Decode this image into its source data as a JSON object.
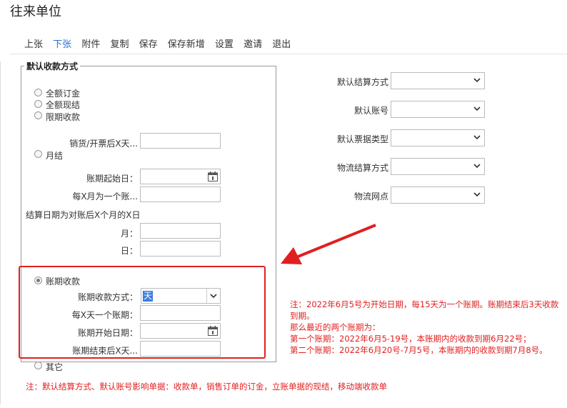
{
  "title": "往来单位",
  "toolbar": [
    {
      "label": "上张"
    },
    {
      "label": "下张"
    },
    {
      "label": "附件"
    },
    {
      "label": "复制"
    },
    {
      "label": "保存"
    },
    {
      "label": "保存新增"
    },
    {
      "label": "设置"
    },
    {
      "label": "邀请"
    },
    {
      "label": "退出"
    }
  ],
  "fieldset_legend": "默认收款方式",
  "radios": {
    "full_order": "全额订金",
    "full_cash": "全额现结",
    "limited": "限期收款",
    "monthly": "月结",
    "period": "账期收款",
    "other": "其它"
  },
  "fields": {
    "sale_after_days": "销货/开票后X天...",
    "period_start_date": "账期起始日：",
    "every_x_months": "每X月为一个账...",
    "settle_desc": "结算日期为对账后X个月的X日",
    "month": "月：",
    "day": "日：",
    "period_method": "账期收款方式：",
    "period_method_value": "天",
    "every_x_days": "每X天一个账期：",
    "period_begin_date": "账期开始日期：",
    "period_end_after": "账期结束后X天..."
  },
  "right_fields": [
    {
      "label": "默认结算方式"
    },
    {
      "label": "默认账号"
    },
    {
      "label": "默认票据类型"
    },
    {
      "label": "物流结算方式"
    },
    {
      "label": "物流网点"
    }
  ],
  "red_note": [
    "注：2022年6月5号为开始日期，每15天为一个账期。账期结束后3天收款",
    "到期。",
    "那么最近的两个账期为：",
    "第一个账期：2022年6月5-19号，本账期内的收款到期6月22号；",
    "第二个账期：2022年6月20号-7月5号，本账期内的收款到期7月8号。"
  ],
  "bottom_note": "注：默认结算方式、默认账号影响单据：收款单，销售订单的订金，立账单据的现结，移动端收款单",
  "colors": {
    "accent": "#2a6fd6",
    "annotation": "#e02020"
  }
}
